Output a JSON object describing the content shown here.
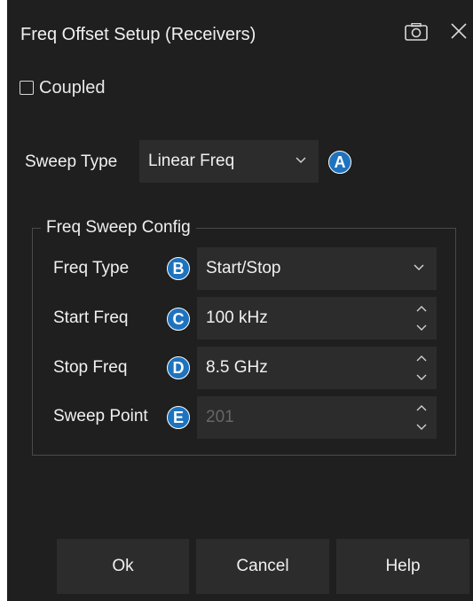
{
  "dialog": {
    "title": "Freq Offset Setup (Receivers)"
  },
  "coupled": {
    "label": "Coupled",
    "checked": false
  },
  "sweep_type": {
    "label": "Sweep Type",
    "value": "Linear Freq",
    "badge": "A"
  },
  "freq_sweep_config": {
    "title": "Freq Sweep Config",
    "freq_type": {
      "label": "Freq Type",
      "value": "Start/Stop",
      "badge": "B"
    },
    "start_freq": {
      "label": "Start Freq",
      "value": "100 kHz",
      "badge": "C"
    },
    "stop_freq": {
      "label": "Stop Freq",
      "value": "8.5 GHz",
      "badge": "D"
    },
    "sweep_point": {
      "label": "Sweep Point",
      "value": "201",
      "badge": "E"
    }
  },
  "buttons": {
    "ok": "Ok",
    "cancel": "Cancel",
    "help": "Help"
  },
  "colors": {
    "background": "#1f1f1f",
    "field": "#2c2c2c",
    "badge": "#1e73be",
    "text": "#f0f0f0",
    "disabled_text": "#666666"
  }
}
